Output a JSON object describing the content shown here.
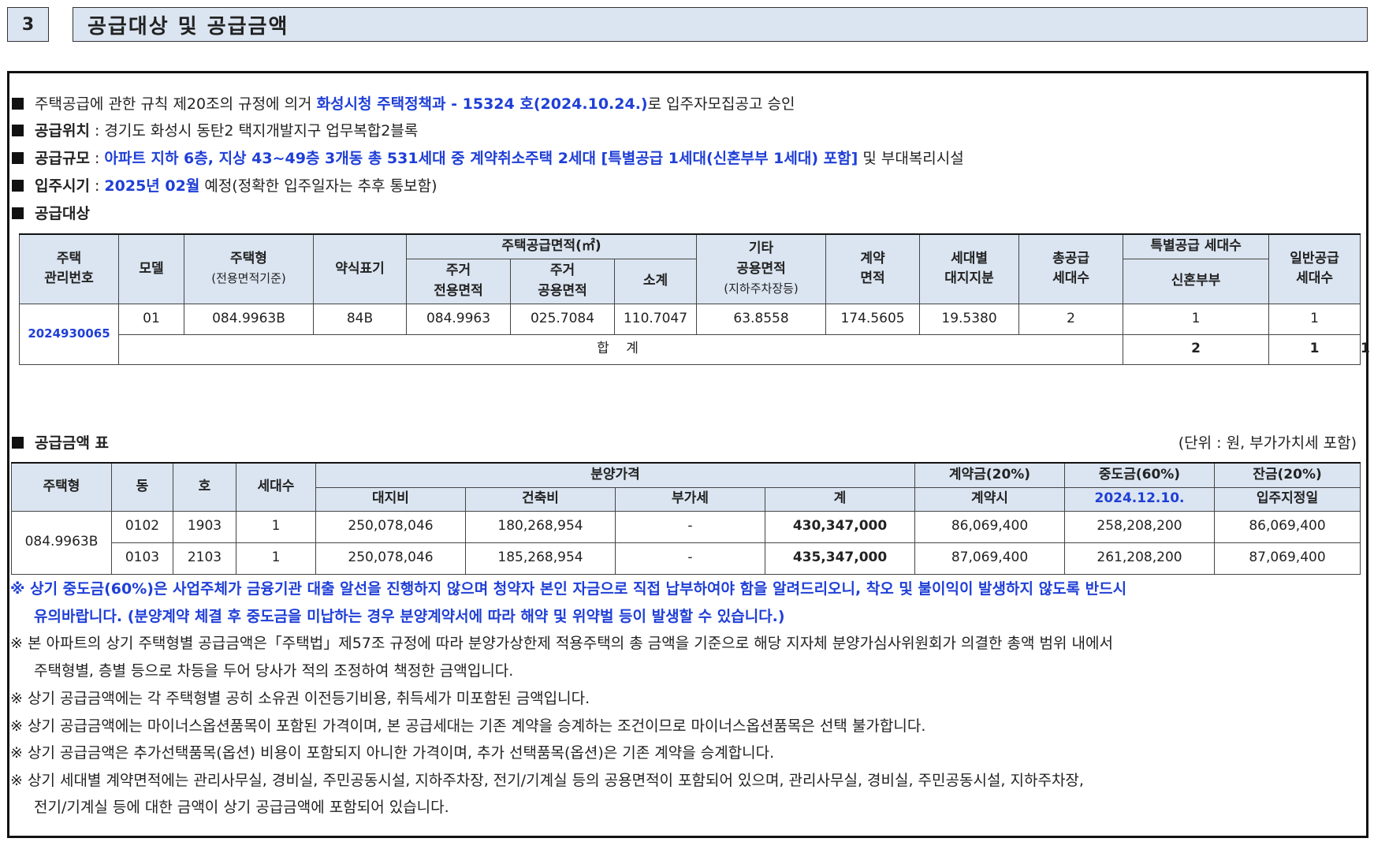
{
  "section": {
    "number": "3",
    "title": "공급대상 및 공급금액"
  },
  "info": {
    "line1_pre": "주택공급에 관한 규칙 제20조의 규정에 의거 ",
    "line1_blue": "화성시청 주택정책과 - 15324 호(2024.10.24.)",
    "line1_post": "로 입주자모집공고 승인",
    "loc_label": "공급위치",
    "loc_value": " : 경기도 화성시 동탄2 택지개발지구 업무복합2블록",
    "scale_label": "공급규모",
    "scale_colon": " : ",
    "scale_blue": "아파트 지하 6층, 지상 43~49층 3개동 총 531세대 중 계약취소주택 2세대 [특별공급 1세대(신혼부부 1세대) 포함]",
    "scale_post": " 및 부대복리시설",
    "movein_label": "입주시기",
    "movein_colon": " : ",
    "movein_blue": "2025년 02월",
    "movein_post": " 예정(정확한 입주일자는 추후 통보함)",
    "target_label": "공급대상"
  },
  "supply_table": {
    "h_id": "주택\n관리번호",
    "h_model": "모델",
    "h_type": "주택형",
    "h_type_sub": "(전용면적기준)",
    "h_short": "약식표기",
    "h_area": "주택공급면적(㎡)",
    "h_excl": "주거\n전용면적",
    "h_common": "주거\n공용면적",
    "h_subtotal": "소계",
    "h_other": "기타\n공용면적",
    "h_other_sub": "(지하주차장등)",
    "h_contract": "계약\n면적",
    "h_land": "세대별\n대지지분",
    "h_total": "총공급\n세대수",
    "h_special": "특별공급 세대수",
    "h_newlywed": "신혼부부",
    "h_general": "일반공급\n세대수",
    "row": {
      "id": "2024930065",
      "model": "01",
      "type": "084.9963B",
      "short": "84B",
      "excl": "084.9963",
      "common": "025.7084",
      "subtotal": "110.7047",
      "other": "63.8558",
      "contract": "174.5605",
      "land": "19.5380",
      "total": "2",
      "newlywed": "1",
      "general": "1"
    },
    "sum_label": "합 계",
    "sum_total": "2",
    "sum_newlywed": "1",
    "sum_general": "1"
  },
  "price": {
    "label": "공급금액 표",
    "unit": "(단위 : 원, 부가가치세 포함)",
    "h_type": "주택형",
    "h_dong": "동",
    "h_ho": "호",
    "h_units": "세대수",
    "h_price": "분양가격",
    "h_land": "대지비",
    "h_build": "건축비",
    "h_vat": "부가세",
    "h_sum": "계",
    "h_deposit": "계약금(20%)",
    "h_deposit_sub": "계약시",
    "h_middle": "중도금(60%)",
    "h_middle_sub": "2024.12.10.",
    "h_balance": "잔금(20%)",
    "h_balance_sub": "입주지정일",
    "type": "084.9963B",
    "rows": [
      {
        "dong": "0102",
        "ho": "1903",
        "units": "1",
        "land": "250,078,046",
        "build": "180,268,954",
        "vat": "-",
        "sum": "430,347,000",
        "deposit": "86,069,400",
        "middle": "258,208,200",
        "balance": "86,069,400"
      },
      {
        "dong": "0103",
        "ho": "2103",
        "units": "1",
        "land": "250,078,046",
        "build": "185,268,954",
        "vat": "-",
        "sum": "435,347,000",
        "deposit": "87,069,400",
        "middle": "261,208,200",
        "balance": "87,069,400"
      }
    ]
  },
  "notes": {
    "n1a": "※ 상기 중도금(60%)은 사업주체가 금융기관 대출 알선을 진행하지 않으며 청약자 본인 자금으로 직접 납부하여야 함을 알려드리오니, 착오 및 불이익이 발생하지 않도록 반드시",
    "n1b": "유의바랍니다. (분양계약 체결 후 중도금을 미납하는 경우 분양계약서에 따라 해약 및 위약벌 등이 발생할 수 있습니다.)",
    "n2a": "※ 본 아파트의 상기 주택형별 공급금액은「주택법」제57조 규정에 따라 분양가상한제 적용주택의 총 금액을 기준으로 해당 지자체 분양가심사위원회가 의결한 총액 범위 내에서",
    "n2b": "주택형별, 층별 등으로 차등을 두어 당사가 적의 조정하여 책정한 금액입니다.",
    "n3": "※ 상기 공급금액에는 각 주택형별 공히 소유권 이전등기비용, 취득세가 미포함된 금액입니다.",
    "n4": "※ 상기 공급금액에는 마이너스옵션품목이 포함된 가격이며, 본 공급세대는 기존 계약을 승계하는 조건이므로 마이너스옵션품목은 선택 불가합니다.",
    "n5": "※ 상기 공급금액은 추가선택품목(옵션) 비용이 포함되지 아니한 가격이며, 추가 선택품목(옵션)은 기존 계약을 승계합니다.",
    "n6a": "※ 상기 세대별 계약면적에는 관리사무실, 경비실, 주민공동시설, 지하주차장, 전기/기계실 등의 공용면적이 포함되어 있으며, 관리사무실, 경비실, 주민공동시설, 지하주차장,",
    "n6b": "전기/기계실 등에 대한 금액이 상기 공급금액에 포함되어 있습니다."
  }
}
